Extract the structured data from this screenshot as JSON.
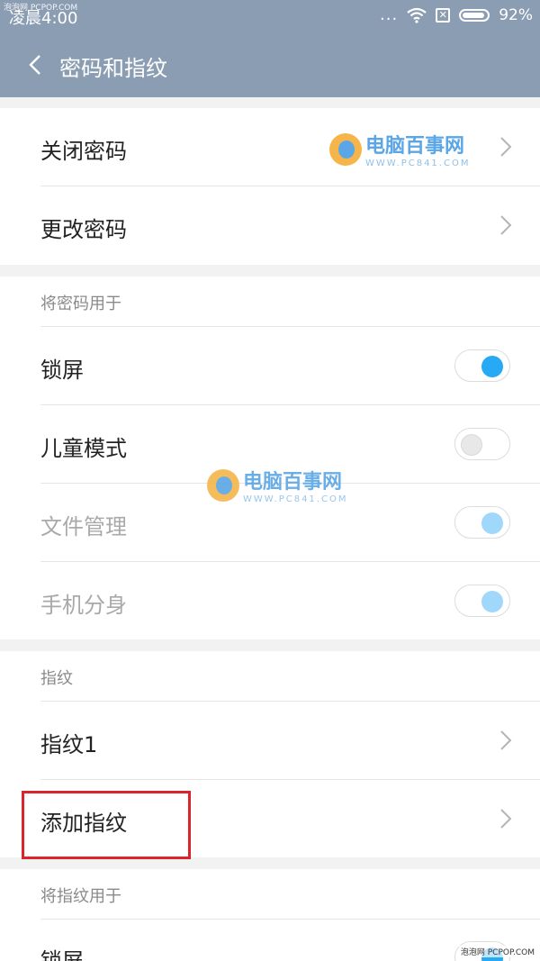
{
  "status_bar": {
    "tiny_label": "泡泡网 PCPOP.COM",
    "time": "凌晨4:00",
    "dots": "...",
    "battery_percent": "92%"
  },
  "header": {
    "title": "密码和指纹"
  },
  "password_section": {
    "items": [
      {
        "label": "关闭密码"
      },
      {
        "label": "更改密码"
      }
    ]
  },
  "use_password_section": {
    "heading": "将密码用于",
    "items": [
      {
        "label": "锁屏",
        "state": "on"
      },
      {
        "label": "儿童模式",
        "state": "off"
      },
      {
        "label": "文件管理",
        "state": "on-disabled"
      },
      {
        "label": "手机分身",
        "state": "on-disabled"
      }
    ]
  },
  "fingerprint_section": {
    "heading": "指纹",
    "items": [
      {
        "label": "指纹1"
      },
      {
        "label": "添加指纹"
      }
    ]
  },
  "use_fingerprint_section": {
    "heading": "将指纹用于",
    "items": [
      {
        "label": "锁屏",
        "state": "on"
      }
    ]
  },
  "watermark": {
    "name": "电脑百事网",
    "url": "WWW.PC841.COM"
  },
  "corner_tag": "泡泡网 PCPOP.COM",
  "colors": {
    "header_bg": "#8b9db3",
    "toggle_on": "#27a9f3",
    "highlight": "#d9252b"
  }
}
